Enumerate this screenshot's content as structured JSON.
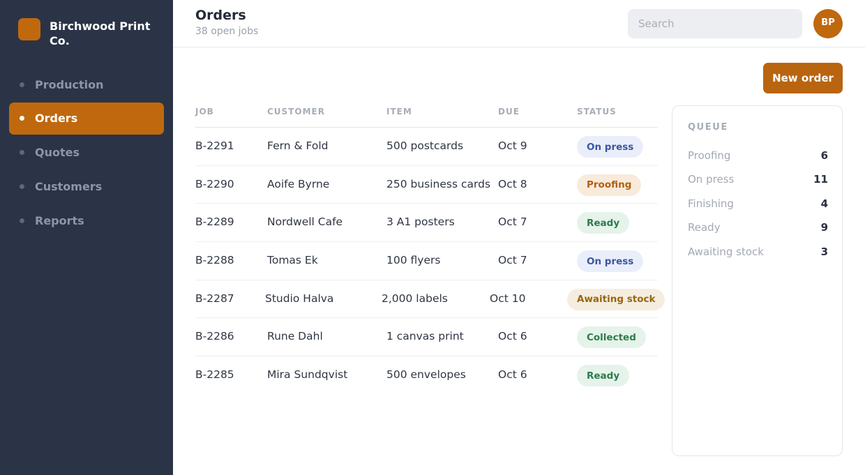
{
  "brand": {
    "name": "Birchwood Print Co.",
    "logo_color": "#c0680e"
  },
  "nav": [
    {
      "label": "Production",
      "active": false
    },
    {
      "label": "Orders",
      "active": true
    },
    {
      "label": "Quotes",
      "active": false
    },
    {
      "label": "Customers",
      "active": false
    },
    {
      "label": "Reports",
      "active": false
    }
  ],
  "header": {
    "title": "Orders",
    "subtitle": "38 open jobs",
    "search_placeholder": "Search",
    "avatar_initials": "BP"
  },
  "actions": {
    "new_order_label": "New order"
  },
  "table": {
    "columns": [
      "JOB",
      "CUSTOMER",
      "ITEM",
      "DUE",
      "STATUS"
    ],
    "rows": [
      {
        "job": "B-2291",
        "customer": "Fern & Fold",
        "item": "500 postcards",
        "due": "Oct 9",
        "status": "On press"
      },
      {
        "job": "B-2290",
        "customer": "Aoife Byrne",
        "item": "250 business cards",
        "due": "Oct 8",
        "status": "Proofing"
      },
      {
        "job": "B-2289",
        "customer": "Nordwell Cafe",
        "item": "3 A1 posters",
        "due": "Oct 7",
        "status": "Ready"
      },
      {
        "job": "B-2288",
        "customer": "Tomas Ek",
        "item": "100 flyers",
        "due": "Oct 7",
        "status": "On press"
      },
      {
        "job": "B-2287",
        "customer": "Studio Halva",
        "item": "2,000 labels",
        "due": "Oct 10",
        "status": "Awaiting stock"
      },
      {
        "job": "B-2286",
        "customer": "Rune Dahl",
        "item": "1 canvas print",
        "due": "Oct 6",
        "status": "Collected"
      },
      {
        "job": "B-2285",
        "customer": "Mira Sundqvist",
        "item": "500 envelopes",
        "due": "Oct 6",
        "status": "Ready"
      }
    ]
  },
  "status_styles": {
    "On press": {
      "bg": "#e9eefa",
      "fg": "#3c55a0"
    },
    "Proofing": {
      "bg": "#f8ebdc",
      "fg": "#b2600f"
    },
    "Ready": {
      "bg": "#e5f3ea",
      "fg": "#2f7a4c"
    },
    "Awaiting stock": {
      "bg": "#f5eddf",
      "fg": "#9a6511"
    },
    "Collected": {
      "bg": "#e5f3ea",
      "fg": "#2f7a4c"
    }
  },
  "queue": {
    "title": "QUEUE",
    "items": [
      {
        "label": "Proofing",
        "count": "6"
      },
      {
        "label": "On press",
        "count": "11"
      },
      {
        "label": "Finishing",
        "count": "4"
      },
      {
        "label": "Ready",
        "count": "9"
      },
      {
        "label": "Awaiting stock",
        "count": "3"
      }
    ]
  }
}
